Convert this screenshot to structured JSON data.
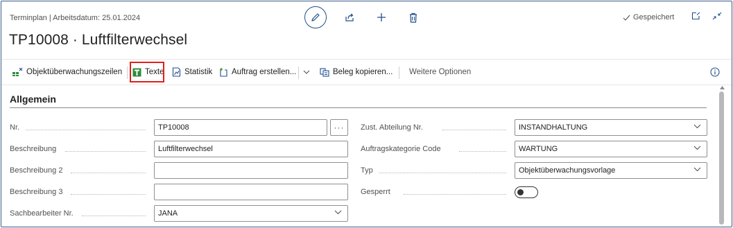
{
  "header": {
    "breadcrumb": "Terminplan | Arbeitsdatum: 25.01.2024",
    "title": "TP10008 · Luftfilterwechsel",
    "saved_label": "Gespeichert",
    "icons": [
      "edit-icon",
      "share-icon",
      "add-icon",
      "delete-icon",
      "open-in-new-window-icon",
      "collapse-icon"
    ]
  },
  "actions": {
    "objektueberwachungszeilen": "Objektüberwachungszeilen",
    "texte": "Texte",
    "statistik": "Statistik",
    "auftrag_erstellen": "Auftrag erstellen...",
    "beleg_kopieren": "Beleg kopieren...",
    "weitere_optionen": "Weitere Optionen"
  },
  "section": {
    "title": "Allgemein"
  },
  "fields_left": {
    "nr": {
      "label": "Nr.",
      "value": "TP10008"
    },
    "beschreibung": {
      "label": "Beschreibung",
      "value": "Luftfilterwechsel"
    },
    "beschreibung2": {
      "label": "Beschreibung 2",
      "value": ""
    },
    "beschreibung3": {
      "label": "Beschreibung 3",
      "value": ""
    },
    "sachbearbeiter": {
      "label": "Sachbearbeiter Nr.",
      "value": "JANA"
    }
  },
  "fields_right": {
    "abteilung": {
      "label": "Zust. Abteilung Nr.",
      "value": "INSTANDHALTUNG"
    },
    "kategorie": {
      "label": "Auftragskategorie Code",
      "value": "WARTUNG"
    },
    "typ": {
      "label": "Typ",
      "value": "Objektüberwachungsvorlage"
    },
    "gesperrt": {
      "label": "Gesperrt",
      "value": false
    }
  },
  "colors": {
    "accent": "#1f4e8c",
    "highlight": "#e0201b",
    "green_icon": "#2e8b3a"
  }
}
